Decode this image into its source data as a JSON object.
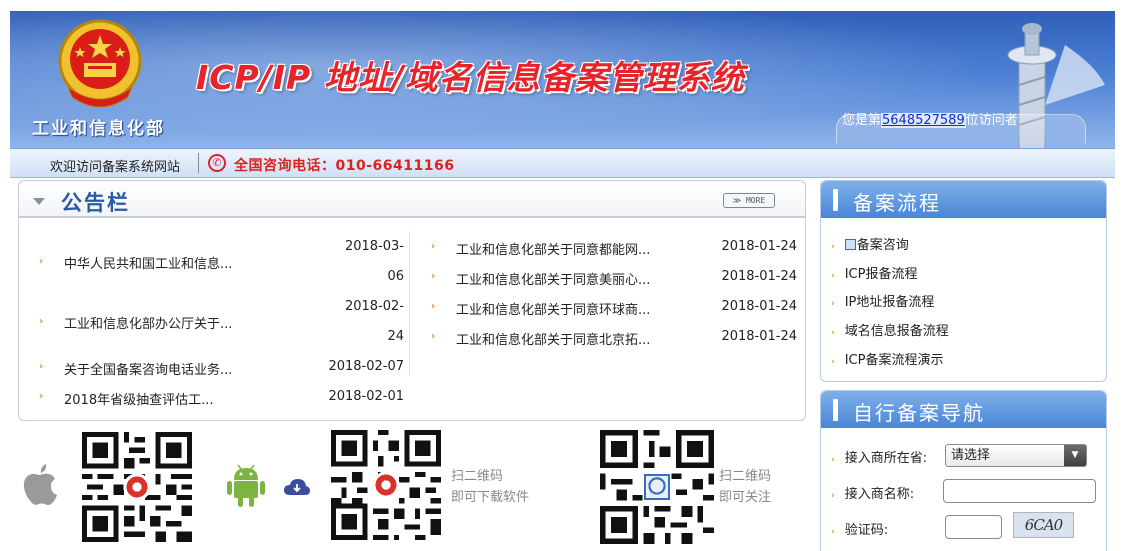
{
  "banner": {
    "ministry": "工业和信息化部",
    "system_title": "ICP/IP 地址/域名信息备案管理系统",
    "visitor_prefix": "您是第",
    "visitor_count": "5648527589",
    "visitor_suffix": "位访问者"
  },
  "infobar": {
    "welcome": "欢迎访问备案系统网站",
    "hotline": "全国咨询电话：010-66411166"
  },
  "notice": {
    "title": "公告栏",
    "more_label": "≫ MORE",
    "left": [
      {
        "title": "中华人民共和国工业和信息...",
        "date_line1": "2018-03-",
        "date_line2": "06"
      },
      {
        "title": "工业和信息化部办公厅关于...",
        "date_line1": "2018-02-",
        "date_line2": "24"
      },
      {
        "title": "关于全国备案咨询电话业务...",
        "date": "2018-02-07"
      },
      {
        "title": "2018年省级抽查评估工...",
        "date": "2018-02-01"
      }
    ],
    "right": [
      {
        "title": "工业和信息化部关于同意都能网...",
        "date": "2018-01-24"
      },
      {
        "title": "工业和信息化部关于同意美丽心...",
        "date": "2018-01-24"
      },
      {
        "title": "工业和信息化部关于同意环球商...",
        "date": "2018-01-24"
      },
      {
        "title": "工业和信息化部关于同意北京拓...",
        "date": "2018-01-24"
      }
    ]
  },
  "qr": {
    "caption_download_1": "扫二维码",
    "caption_download_2": "即可下载软件",
    "caption_follow_1": "扫二维码",
    "caption_follow_2": "即可关注"
  },
  "flow": {
    "title": "备案流程",
    "items": [
      "备案咨询",
      "ICP报备流程",
      "IP地址报备流程",
      "域名信息报备流程",
      "ICP备案流程演示"
    ]
  },
  "nav": {
    "title": "自行备案导航",
    "province_label": "接入商所在省:",
    "province_value": "请选择",
    "name_label": "接入商名称:",
    "captcha_label": "验证码:",
    "captcha_text": "6CA0"
  },
  "colors": {
    "banner_blue": "#2f5fb8",
    "title_red": "#e8232a",
    "notice_blue": "#2a5aa8",
    "bullet_orange": "#e08a2a"
  }
}
